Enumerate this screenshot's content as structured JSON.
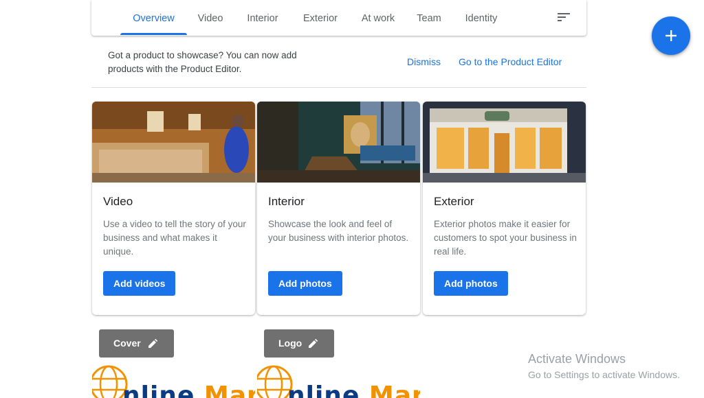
{
  "tabs": [
    {
      "label": "Overview",
      "active": true
    },
    {
      "label": "Video"
    },
    {
      "label": "Interior"
    },
    {
      "label": "Exterior"
    },
    {
      "label": "At work"
    },
    {
      "label": "Team"
    },
    {
      "label": "Identity"
    }
  ],
  "toolbar": {
    "filter_icon": "sort-filter-icon",
    "fab_icon": "plus-icon"
  },
  "banner": {
    "line1": "Got a product to showcase? You can now add",
    "line2": "products with the Product Editor.",
    "dismiss": "Dismiss",
    "go_to_editor": "Go to the Product Editor"
  },
  "cards": [
    {
      "title": "Video",
      "description": "Use a video to tell the story of your business and what makes it unique.",
      "button": "Add videos"
    },
    {
      "title": "Interior",
      "description": "Showcase the look and feel of your business with interior photos.",
      "button": "Add photos"
    },
    {
      "title": "Exterior",
      "description": "Exterior photos make it easier for customers to spot your business in real life.",
      "button": "Add photos"
    }
  ],
  "identity": {
    "cover_label": "Cover",
    "logo_label": "Logo",
    "edit_icon": "pencil-icon"
  },
  "logo_image": {
    "part1": "nline",
    "part2": "Marke"
  },
  "watermark": {
    "title": "Activate Windows",
    "subtitle": "Go to Settings to activate Windows."
  },
  "colors": {
    "accent": "#1a73e8",
    "chip": "#707070",
    "brand_blue": "#0d3b82",
    "brand_orange": "#f39200"
  }
}
